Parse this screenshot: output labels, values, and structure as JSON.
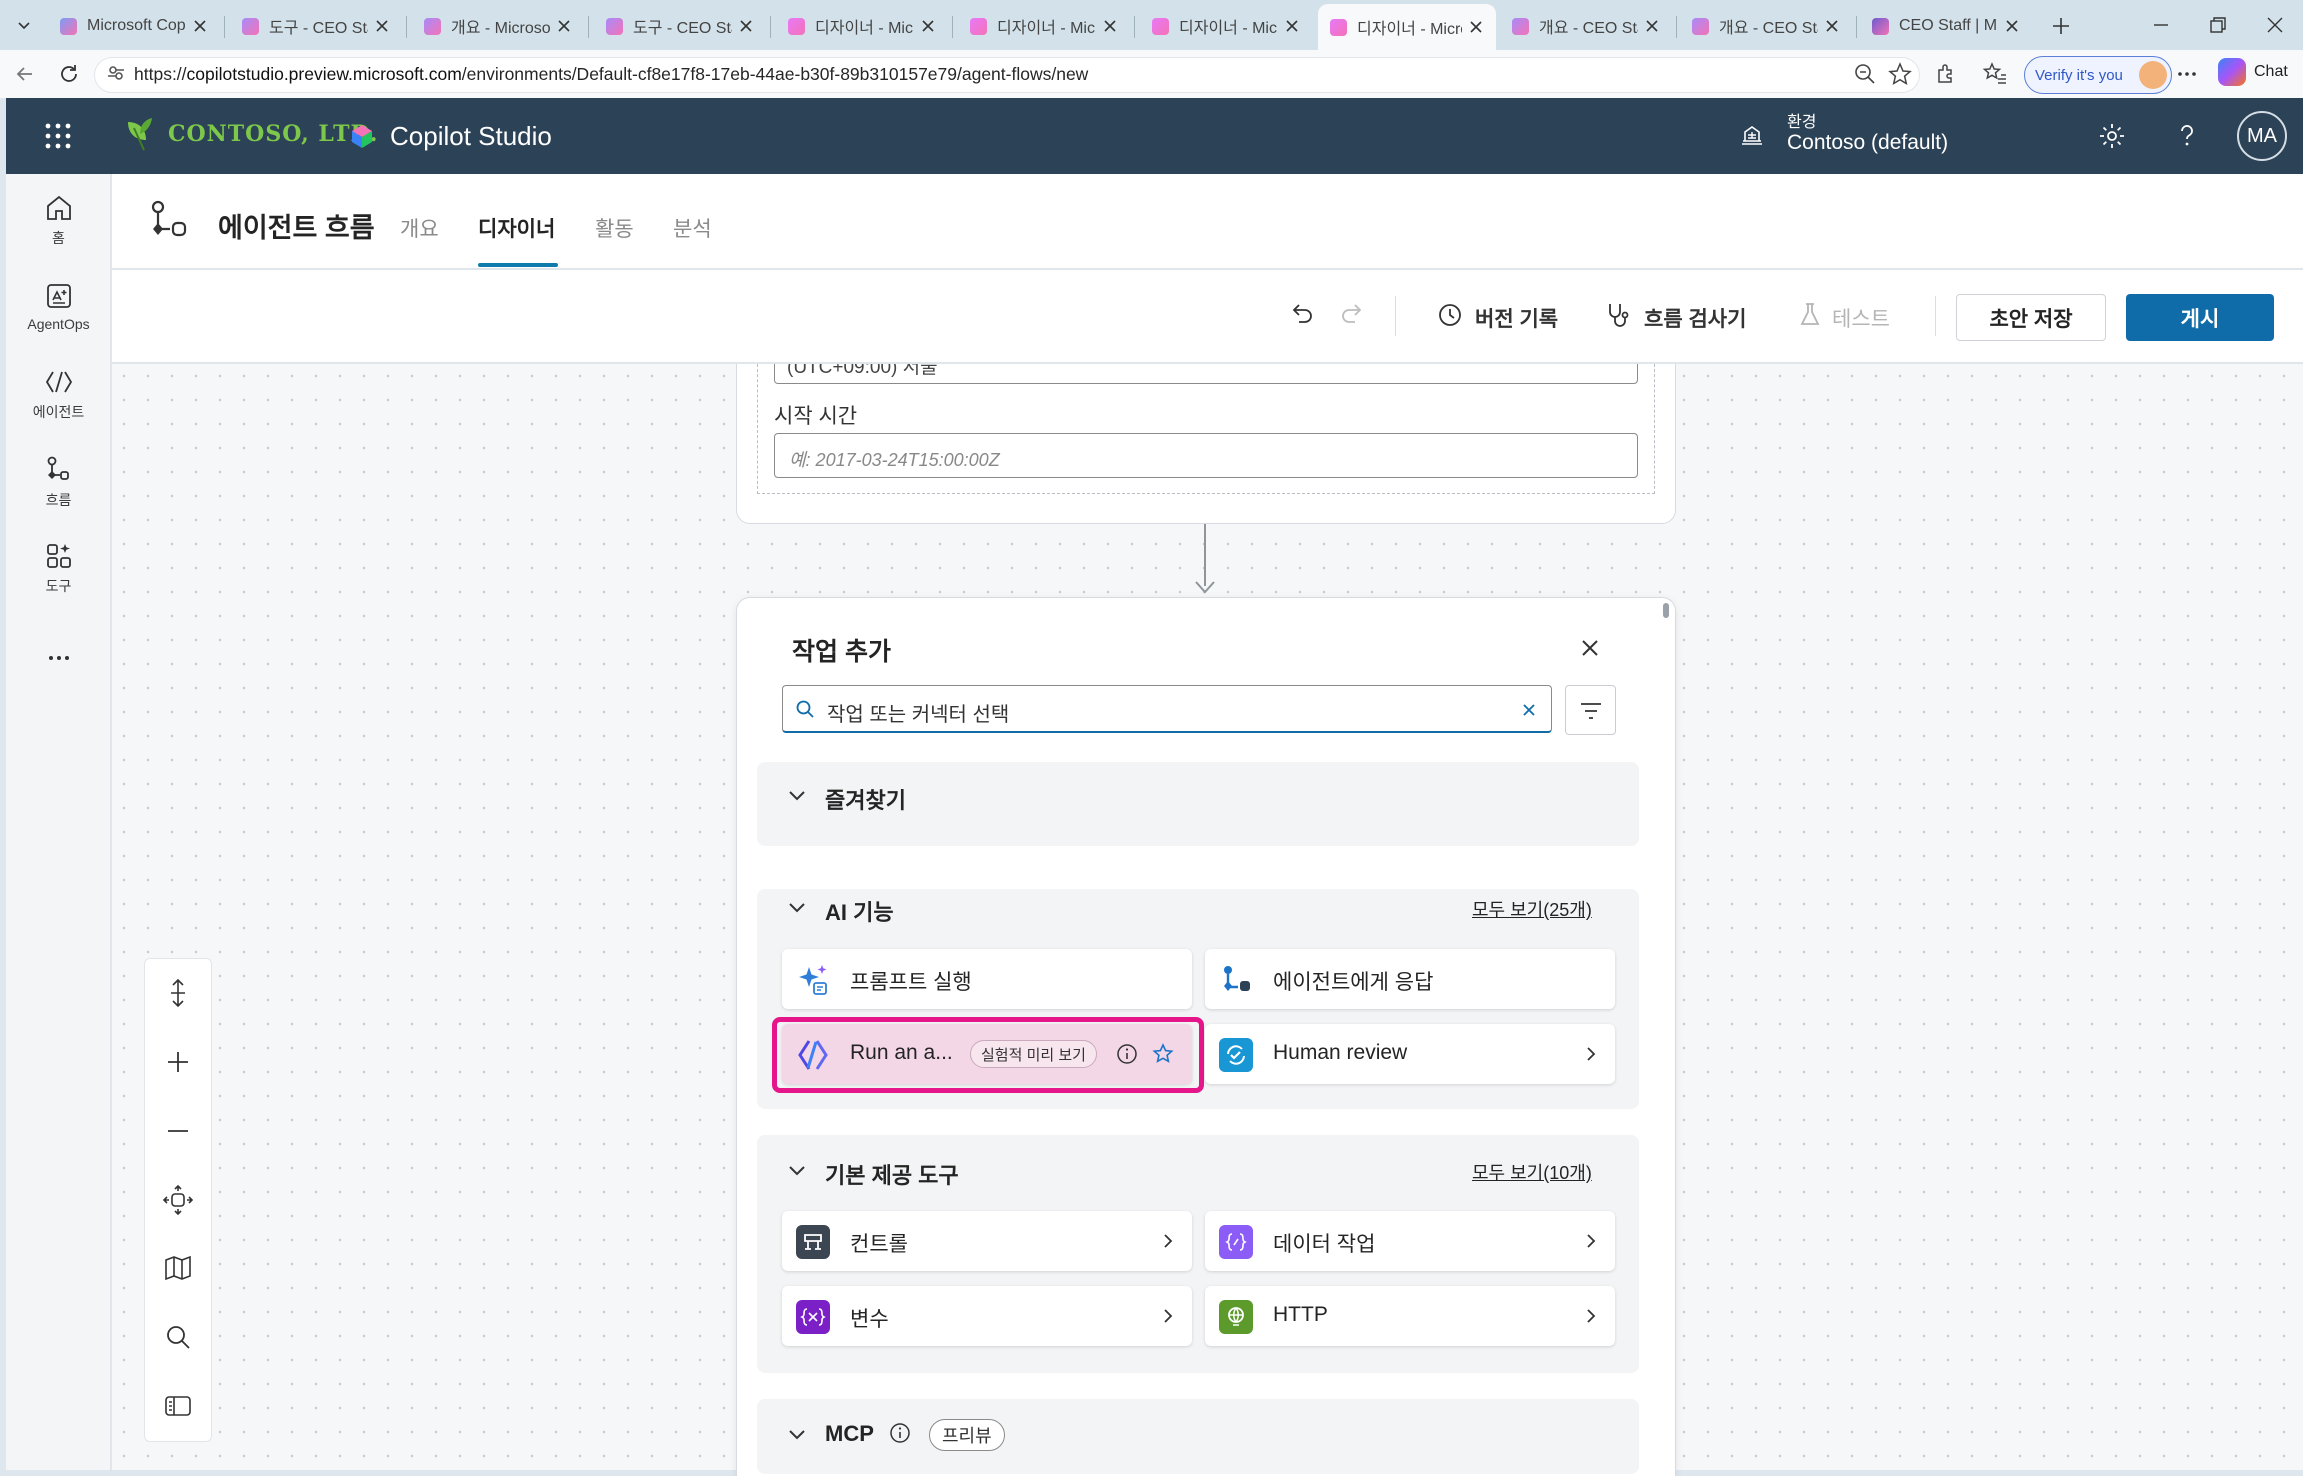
{
  "browser": {
    "tabs": [
      {
        "title": "Microsoft Copilo",
        "active": false
      },
      {
        "title": "도구 - CEO Staff",
        "active": false
      },
      {
        "title": "개요 - Microsoft",
        "active": false
      },
      {
        "title": "도구 - CEO Staff",
        "active": false
      },
      {
        "title": "디자이너 - Micro",
        "active": false
      },
      {
        "title": "디자이너 - Micro",
        "active": false
      },
      {
        "title": "디자이너 - Micro",
        "active": false
      },
      {
        "title": "디자이너 - Micro",
        "active": true
      },
      {
        "title": "개요 - CEO Staff",
        "active": false
      },
      {
        "title": "개요 - CEO Staff",
        "active": false
      },
      {
        "title": "CEO Staff | Micro",
        "active": false
      }
    ],
    "url_prefix": "https://",
    "url_host": "copilotstudio.preview.microsoft.com",
    "url_path": "/environments/Default-cf8e17f8-17eb-44ae-b30f-89b310157e79/agent-flows/new",
    "verify_label": "Verify it's you",
    "chat_label": "Chat"
  },
  "app": {
    "company": "CONTOSO, LTD.",
    "product": "Copilot Studio",
    "env_label": "환경",
    "env_name": "Contoso (default)",
    "avatar_initials": "MA"
  },
  "rail": {
    "items": [
      {
        "label": "홈",
        "icon": "home-icon"
      },
      {
        "label": "AgentOps",
        "icon": "agentops-icon"
      },
      {
        "label": "에이전트",
        "icon": "agent-icon"
      },
      {
        "label": "흐름",
        "icon": "flow-icon"
      },
      {
        "label": "도구",
        "icon": "tools-icon"
      }
    ]
  },
  "page": {
    "title": "에이전트 흐름",
    "tabs": [
      {
        "label": "개요",
        "active": false
      },
      {
        "label": "디자이너",
        "active": true
      },
      {
        "label": "활동",
        "active": false
      },
      {
        "label": "분석",
        "active": false
      }
    ]
  },
  "toolbar": {
    "version_history": "버전 기록",
    "flow_checker": "흐름 검사기",
    "test": "테스트",
    "save_draft": "초안 저장",
    "publish": "게시"
  },
  "trigger": {
    "timezone_value": "(UTC+09:00) 서울",
    "start_time_label": "시작 시간",
    "start_time_placeholder": "예: 2017-03-24T15:00:00Z"
  },
  "add_action": {
    "title": "작업 추가",
    "search_placeholder": "작업 또는 커넥터 선택",
    "favorites": {
      "title": "즐겨찾기"
    },
    "ai": {
      "title": "AI 기능",
      "see_all": "모두 보기(25개)",
      "items": [
        {
          "label": "프롬프트 실행",
          "icon": "prompt-sparkle-icon"
        },
        {
          "label": "에이전트에게 응답",
          "icon": "agent-respond-icon"
        },
        {
          "label": "Run an a...",
          "icon": "run-agent-icon",
          "badge": "실험적 미리 보기"
        },
        {
          "label": "Human review",
          "icon": "human-review-icon"
        }
      ]
    },
    "builtin": {
      "title": "기본 제공 도구",
      "see_all": "모두 보기(10개)",
      "items": [
        {
          "label": "컨트롤",
          "icon": "control-icon",
          "color": "#3b4652"
        },
        {
          "label": "데이터 작업",
          "icon": "data-operation-icon",
          "color": "#8b5cf6"
        },
        {
          "label": "변수",
          "icon": "variable-icon",
          "color": "#7b1fc7"
        },
        {
          "label": "HTTP",
          "icon": "http-icon",
          "color": "#5d9a2c"
        }
      ]
    },
    "mcp": {
      "title": "MCP",
      "badge": "프리뷰"
    }
  },
  "colors": {
    "header_bg": "#2c4256",
    "accent": "#0f6ca9",
    "highlight": "#e4168a"
  }
}
